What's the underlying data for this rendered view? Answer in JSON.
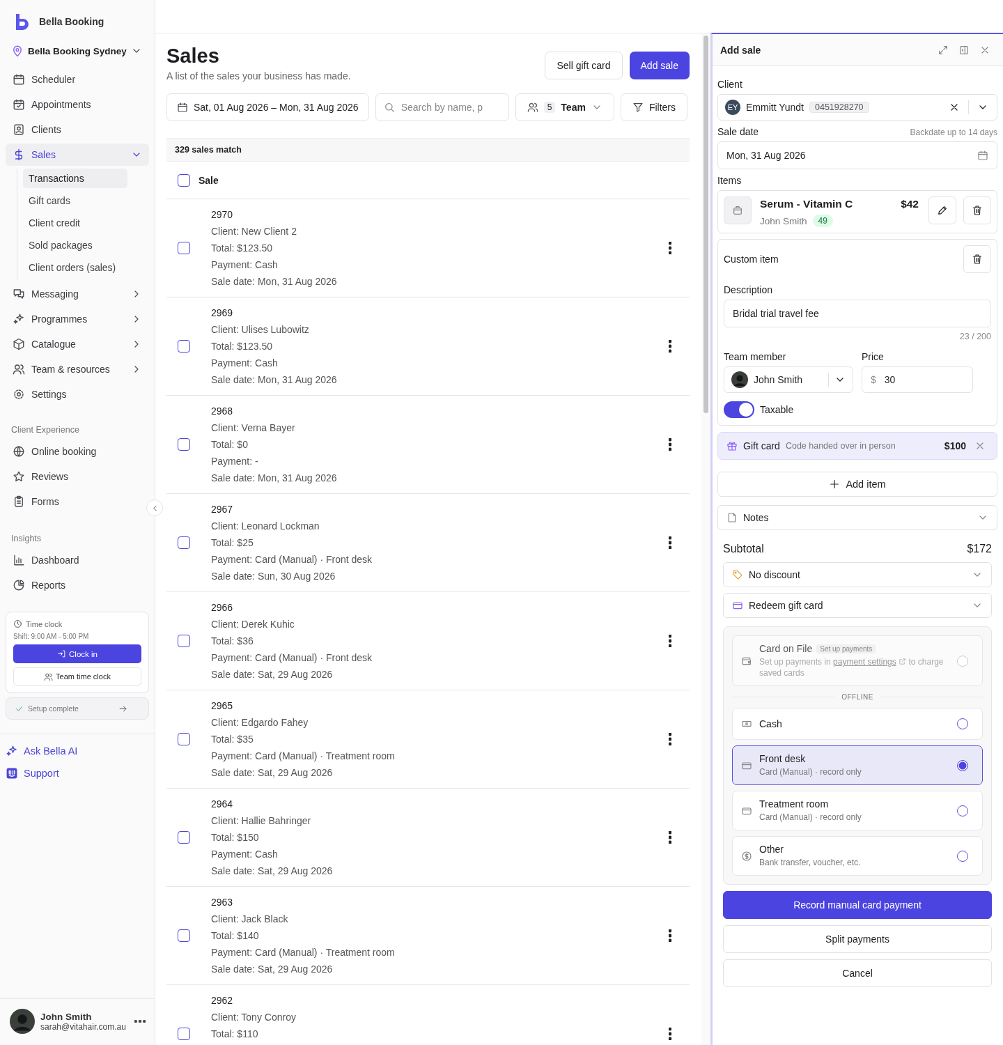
{
  "sidebar": {
    "brand": "Bella Booking",
    "location": "Bella Booking Sydney",
    "nav": [
      {
        "label": "Scheduler",
        "selected": false
      },
      {
        "label": "Appointments",
        "selected": false
      },
      {
        "label": "Clients",
        "selected": false
      },
      {
        "label": "Sales",
        "selected": true,
        "expanded": true,
        "children": [
          {
            "label": "Transactions",
            "selected": true
          },
          {
            "label": "Gift cards",
            "selected": false
          },
          {
            "label": "Client credit",
            "selected": false
          },
          {
            "label": "Sold packages",
            "selected": false
          },
          {
            "label": "Client orders (sales)",
            "selected": false
          }
        ]
      },
      {
        "label": "Messaging",
        "selected": false,
        "expanded": false
      },
      {
        "label": "Programmes",
        "selected": false,
        "expanded": false
      },
      {
        "label": "Catalogue",
        "selected": false,
        "expanded": false
      },
      {
        "label": "Team & resources",
        "selected": false,
        "expanded": false
      },
      {
        "label": "Settings",
        "selected": false
      }
    ],
    "sections": [
      {
        "title": "Client Experience",
        "items": [
          {
            "label": "Online booking",
            "selected": false
          },
          {
            "label": "Reviews",
            "selected": false
          },
          {
            "label": "Forms",
            "selected": false
          }
        ]
      },
      {
        "title": "Insights",
        "items": [
          {
            "label": "Dashboard",
            "selected": false
          },
          {
            "label": "Reports",
            "selected": false
          }
        ]
      }
    ],
    "time_clock": {
      "title": "Time clock",
      "shift": "Shift: 9:00 AM - 5:00 PM",
      "clock_in": "Clock in",
      "team_clock": "Team time clock"
    },
    "setup": {
      "label": "Setup complete"
    },
    "links": [
      "Ask Bella AI",
      "Support"
    ],
    "user": {
      "name": "John Smith",
      "email": "sarah@vitahair.com.au"
    }
  },
  "page": {
    "title": "Sales",
    "subtitle": "A list of the sales your business has made.",
    "buttons": [
      {
        "label": "Sell gift card",
        "kind": "secondary"
      },
      {
        "label": "Add sale",
        "kind": "primary"
      }
    ],
    "filters": {
      "date_range": "Sat, 01 Aug 2026 – Mon, 31 Aug 2026",
      "search_placeholder": "Search by name, p",
      "team_count": "5",
      "team_label": "Team",
      "filters_label": "Filters"
    },
    "table": {
      "summary": "329 sales match",
      "column": "Sale",
      "header_checked": false,
      "rows": [
        {
          "id": "2970",
          "selected": false,
          "lines": [
            "Client: New Client 2",
            "Total: $123.50",
            "Payment: Cash",
            "Sale date: Mon, 31 Aug 2026"
          ]
        },
        {
          "id": "2969",
          "selected": false,
          "lines": [
            "Client: Ulises Lubowitz",
            "Total: $123.50",
            "Payment: Cash",
            "Sale date: Mon, 31 Aug 2026"
          ]
        },
        {
          "id": "2968",
          "selected": false,
          "lines": [
            "Client: Verna Bayer",
            "Total: $0",
            "Payment: -",
            "Sale date: Mon, 31 Aug 2026"
          ]
        },
        {
          "id": "2967",
          "selected": false,
          "lines": [
            "Client: Leonard Lockman",
            "Total: $25",
            "Payment: Card (Manual) · Front desk",
            "Sale date: Sun, 30 Aug 2026"
          ]
        },
        {
          "id": "2966",
          "selected": false,
          "lines": [
            "Client: Derek Kuhic",
            "Total: $36",
            "Payment: Card (Manual) · Front desk",
            "Sale date: Sat, 29 Aug 2026"
          ]
        },
        {
          "id": "2965",
          "selected": false,
          "lines": [
            "Client: Edgardo Fahey",
            "Total: $35",
            "Payment: Card (Manual) · Treatment room",
            "Sale date: Sat, 29 Aug 2026"
          ]
        },
        {
          "id": "2964",
          "selected": false,
          "lines": [
            "Client: Hallie Bahringer",
            "Total: $150",
            "Payment: Cash",
            "Sale date: Sat, 29 Aug 2026"
          ]
        },
        {
          "id": "2963",
          "selected": false,
          "lines": [
            "Client: Jack Black",
            "Total: $140",
            "Payment: Card (Manual) · Treatment room",
            "Sale date: Sat, 29 Aug 2026"
          ]
        },
        {
          "id": "2962",
          "selected": false,
          "lines": [
            "Client: Tony Conroy",
            "Total: $110"
          ]
        }
      ]
    }
  },
  "panel": {
    "title": "Add sale",
    "client": {
      "label": "Client",
      "initials": "EY",
      "name": "Emmitt Yundt",
      "phone": "0451928270"
    },
    "sale_date": {
      "label": "Sale date",
      "hint": "Backdate up to 14 days",
      "value": "Mon, 31 Aug 2026"
    },
    "items_label": "Items",
    "item": {
      "name": "Serum - Vitamin C",
      "price": "$42",
      "staff": "John Smith",
      "badge": "49"
    },
    "custom_item": {
      "title": "Custom item",
      "description_label": "Description",
      "description": "Bridal trial travel fee",
      "counter": "23 / 200",
      "team_label": "Team member",
      "team_member": "John Smith",
      "price_label": "Price",
      "currency": "$",
      "price": "30",
      "taxable_label": "Taxable",
      "taxable": true
    },
    "gift_card": {
      "label": "Gift card",
      "note": "Code handed over in person",
      "amount": "$100"
    },
    "add_item": "Add item",
    "notes": "Notes",
    "subtotal": {
      "label": "Subtotal",
      "value": "$172"
    },
    "discount": "No discount",
    "redeem": "Redeem gift card",
    "payment": {
      "card_on_file": {
        "title": "Card on File",
        "badge": "Set up payments",
        "text_before": "Set up payments in",
        "link": "payment settings",
        "text_after": "to charge saved cards",
        "disabled": true,
        "selected": false
      },
      "divider": "OFFLINE",
      "options": [
        {
          "title": "Cash",
          "selected": false
        },
        {
          "title": "Front desk",
          "subtitle": "Card (Manual) · record only",
          "selected": true
        },
        {
          "title": "Treatment room",
          "subtitle": "Card (Manual) · record only",
          "selected": false
        },
        {
          "title": "Other",
          "subtitle": "Bank transfer, voucher, etc.",
          "selected": false
        }
      ]
    },
    "buttons": [
      {
        "label": "Record manual card payment",
        "kind": "primary"
      },
      {
        "label": "Split payments",
        "kind": "secondary"
      },
      {
        "label": "Cancel",
        "kind": "secondary"
      }
    ]
  }
}
